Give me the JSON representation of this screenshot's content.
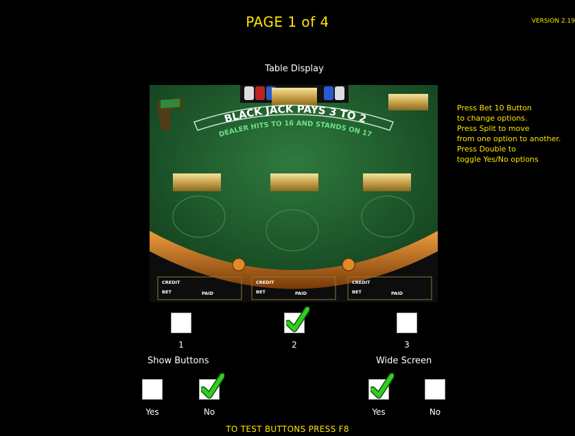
{
  "header": {
    "title": "PAGE 1 of 4",
    "version": "VERSION 2.19"
  },
  "preview": {
    "label": "Table Display",
    "felt_line1": "BLACK JACK PAYS 3 TO 2",
    "felt_line2": "DEALER HITS TO 16 AND STANDS ON 17",
    "box_credit": "CREDIT",
    "box_bet": "BET",
    "box_paid": "PAID"
  },
  "instructions": "Press Bet 10 Button\nto change options.\nPress Split to move\nfrom one option to another.\nPress Double to\ntoggle Yes/No options",
  "layout_options": [
    {
      "label": "1",
      "checked": false
    },
    {
      "label": "2",
      "checked": true
    },
    {
      "label": "3",
      "checked": false
    }
  ],
  "show_buttons": {
    "title": "Show Buttons",
    "yes": {
      "label": "Yes",
      "checked": false
    },
    "no": {
      "label": "No",
      "checked": true
    }
  },
  "wide_screen": {
    "title": "Wide Screen",
    "yes": {
      "label": "Yes",
      "checked": true
    },
    "no": {
      "label": "No",
      "checked": false
    }
  },
  "footer": "TO TEST BUTTONS PRESS F8",
  "colors": {
    "accent": "#ffe600",
    "felt": "#1f5a2c",
    "check": "#33cc22"
  }
}
